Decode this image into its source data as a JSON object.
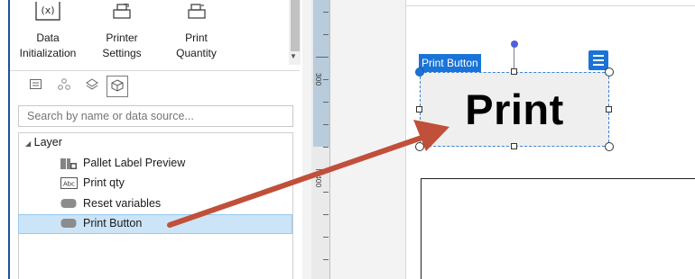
{
  "toolbar": {
    "buttons": [
      {
        "line1": "Data",
        "line2": "Initialization",
        "icon": "variable-icon"
      },
      {
        "line1": "Printer",
        "line2": "Settings",
        "icon": "printer-settings-icon"
      },
      {
        "line1": "Print",
        "line2": "Quantity",
        "icon": "print-quantity-icon"
      }
    ]
  },
  "tabs": [
    {
      "icon": "list-icon",
      "active": false
    },
    {
      "icon": "datasource-icon",
      "active": false
    },
    {
      "icon": "layers-icon",
      "active": false
    },
    {
      "icon": "box-icon",
      "active": true
    }
  ],
  "search": {
    "placeholder": "Search by name or data source..."
  },
  "tree": {
    "root": "Layer",
    "items": [
      {
        "label": "Pallet Label Preview",
        "icon": "barcode-icon",
        "selected": false
      },
      {
        "label": "Print qty",
        "icon": "textbox-icon",
        "selected": false
      },
      {
        "label": "Reset variables",
        "icon": "button-icon",
        "selected": false
      },
      {
        "label": "Print Button",
        "icon": "button-icon",
        "selected": true
      }
    ]
  },
  "ruler": {
    "labels": [
      "300",
      "400"
    ]
  },
  "canvas": {
    "selected_name": "Print Button",
    "button_text": "Print"
  },
  "colors": {
    "accent": "#1a73d6",
    "selection_bg": "#cce4f7",
    "arrow": "#c0503a"
  }
}
